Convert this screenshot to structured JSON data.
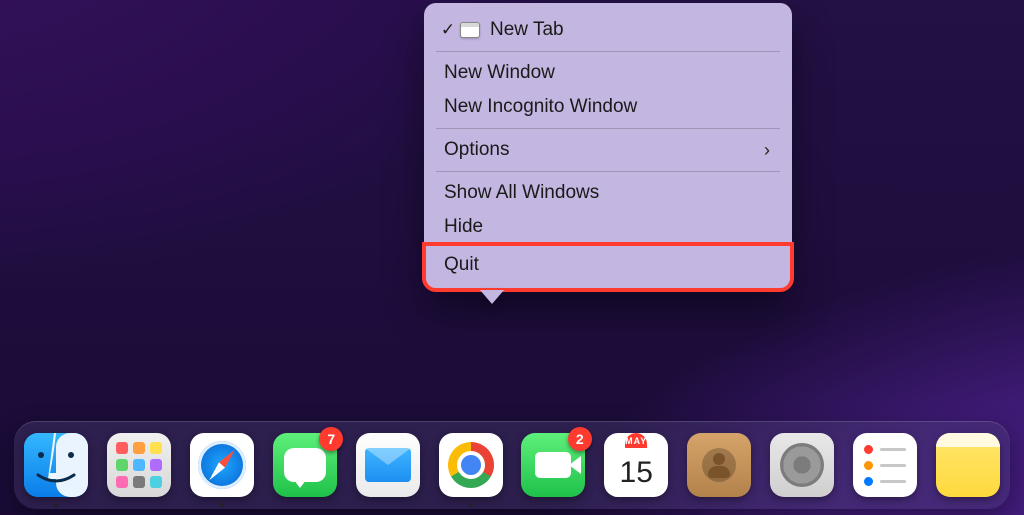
{
  "context_menu": {
    "items": [
      {
        "label": "New Tab",
        "checked": true,
        "section": 0
      },
      {
        "label": "New Window",
        "section": 1
      },
      {
        "label": "New Incognito Window",
        "section": 1
      },
      {
        "label": "Options",
        "has_submenu": true,
        "section": 2
      },
      {
        "label": "Show All Windows",
        "section": 3
      },
      {
        "label": "Hide",
        "section": 3
      },
      {
        "label": "Quit",
        "section": 3,
        "highlighted": true
      }
    ]
  },
  "dock": {
    "items": [
      {
        "name": "finder",
        "running": true
      },
      {
        "name": "launchpad"
      },
      {
        "name": "safari",
        "running": true
      },
      {
        "name": "messages",
        "badge": "7"
      },
      {
        "name": "mail"
      },
      {
        "name": "chrome",
        "running": true
      },
      {
        "name": "facetime",
        "badge": "2"
      },
      {
        "name": "calendar",
        "month": "MAY",
        "day": "15"
      },
      {
        "name": "contacts"
      },
      {
        "name": "settings"
      },
      {
        "name": "reminders"
      },
      {
        "name": "notes"
      }
    ]
  },
  "reminder_colors": [
    "#ff3b30",
    "#ff9500",
    "#007aff"
  ]
}
